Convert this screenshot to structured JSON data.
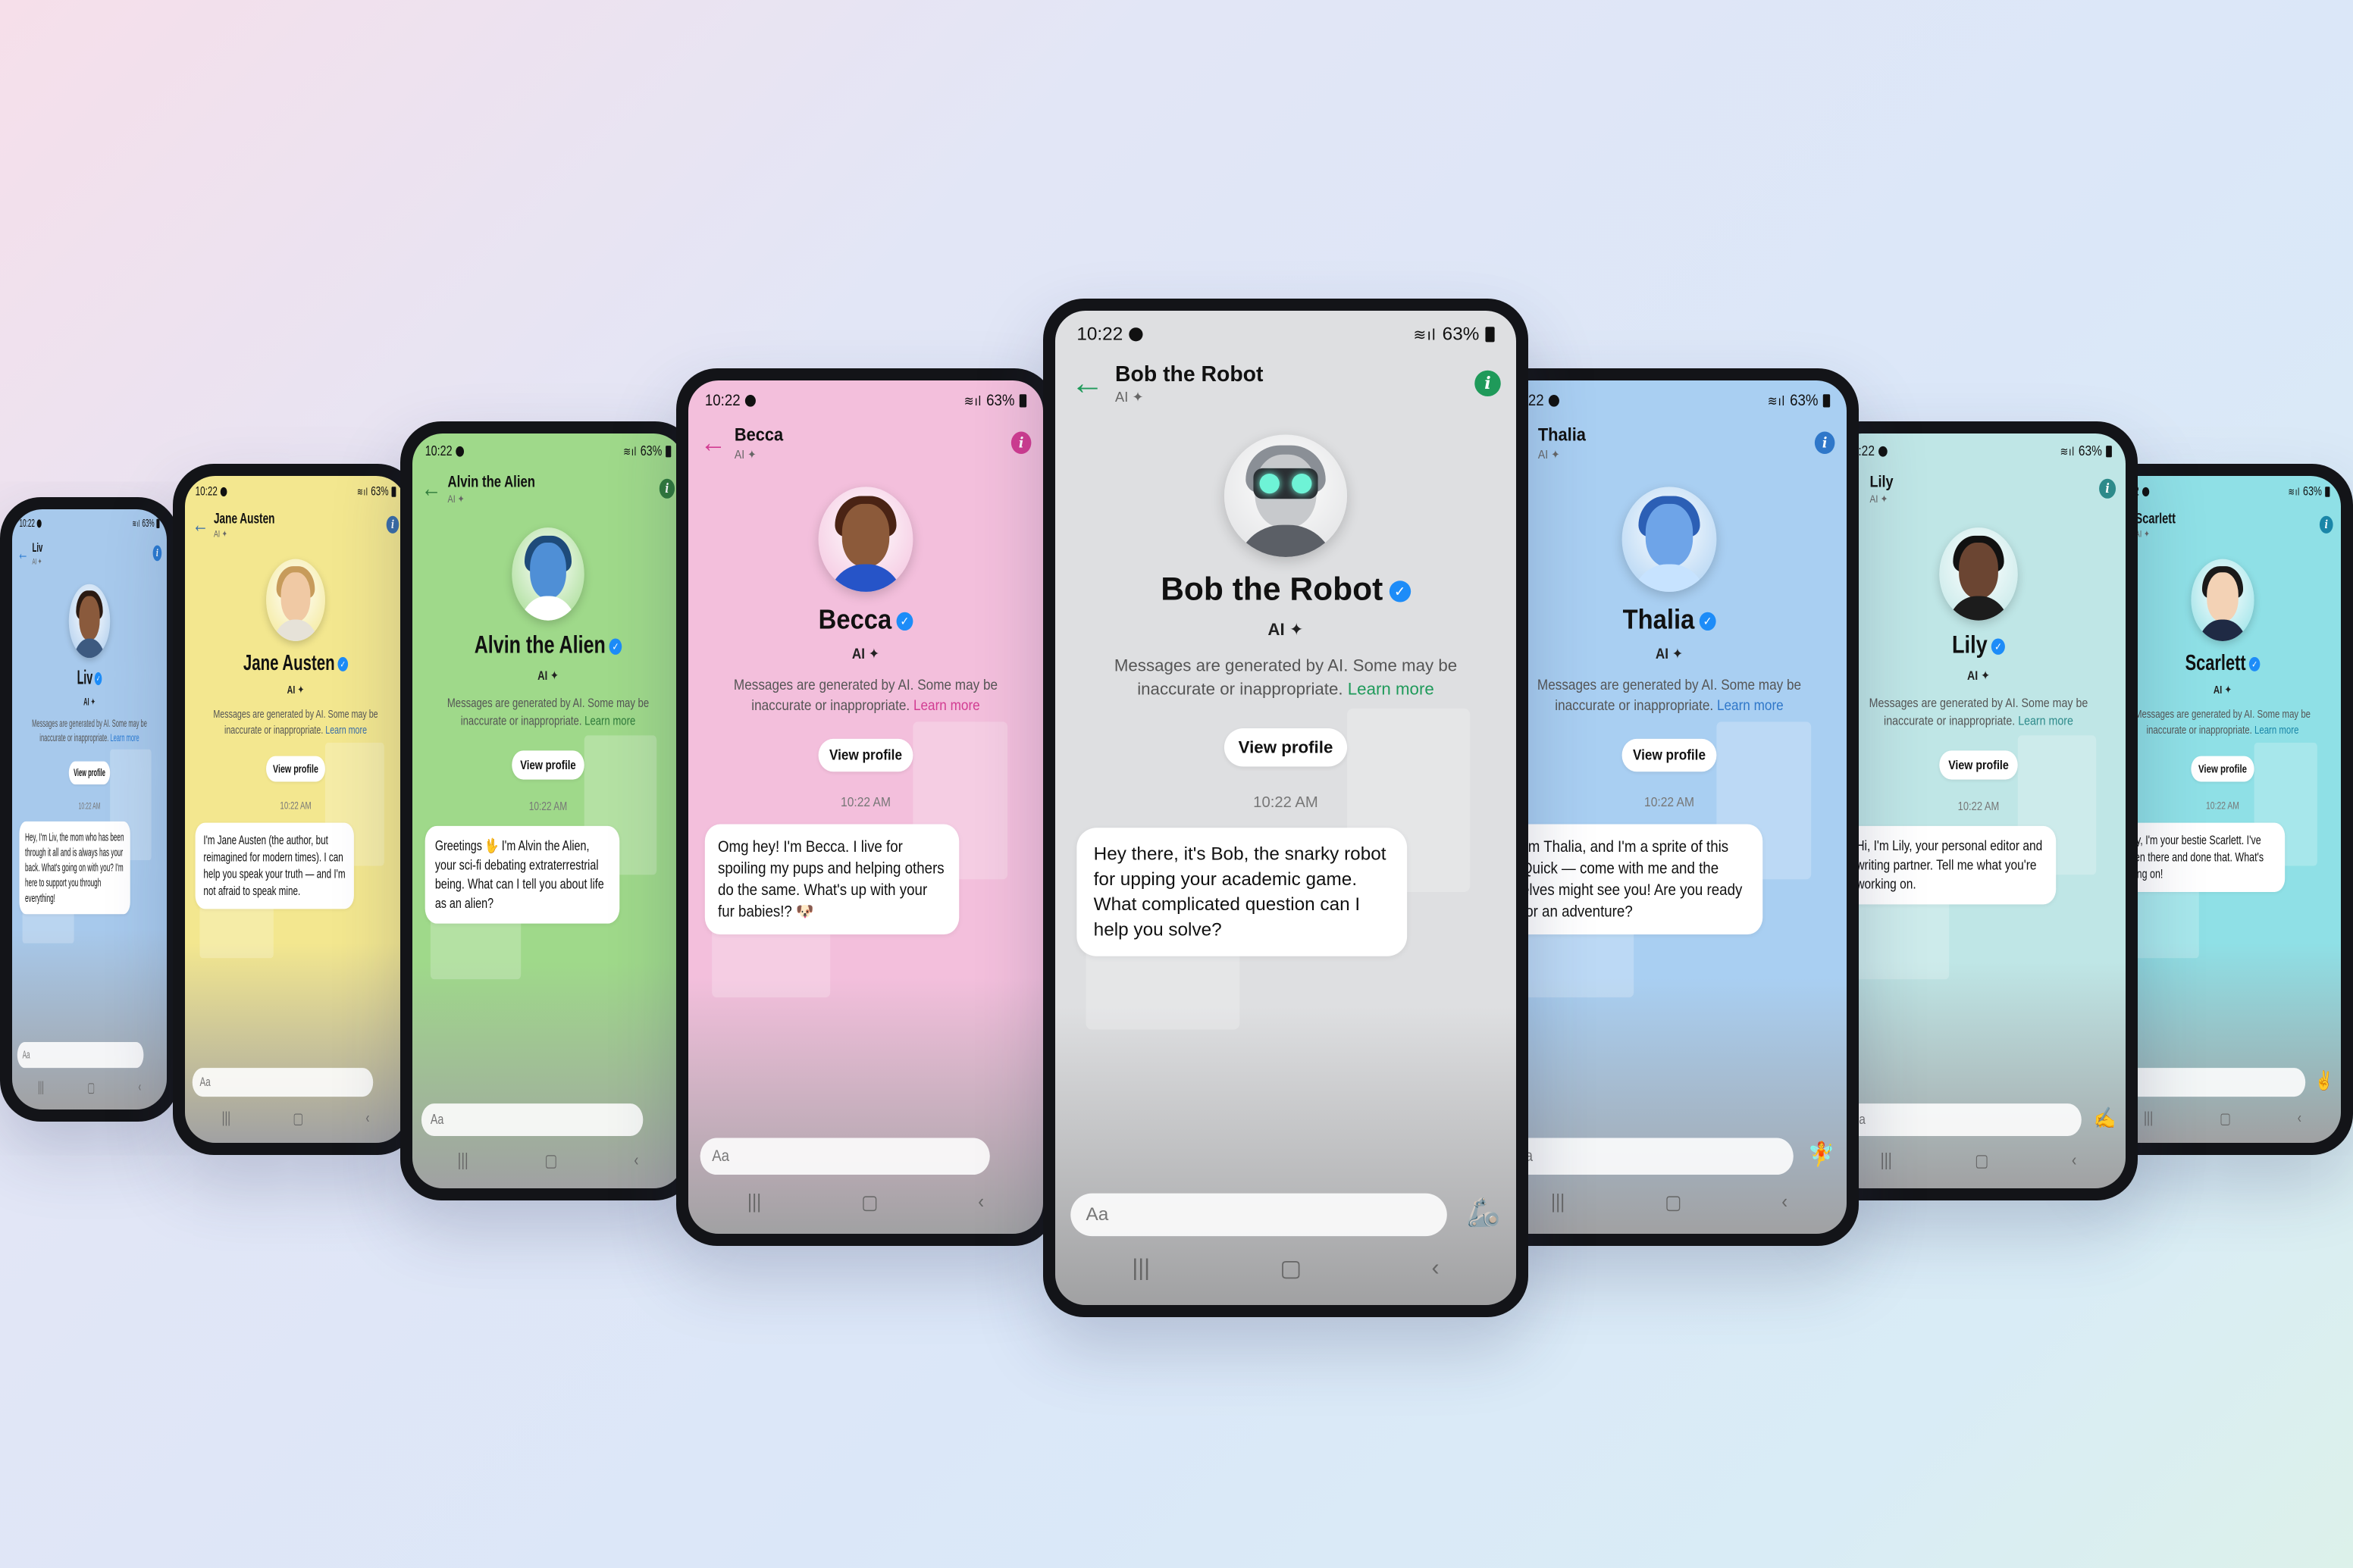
{
  "colors": {
    "verified": "#1d8cf8"
  },
  "icons": {
    "back": "arrow-left-icon",
    "info": "info-icon",
    "verified": "verified-badge-icon",
    "ai_sparkle": "sparkle-icon",
    "nav_recent": "recent-apps-icon",
    "nav_home": "home-icon",
    "nav_back": "nav-back-icon"
  },
  "common": {
    "time": "10:22",
    "battery": "63%",
    "ai_label": "AI ✦",
    "view_profile": "View profile",
    "message_time": "10:22 AM",
    "input_placeholder": "Aa",
    "nav_recent": "|||",
    "nav_home": "▢",
    "nav_back": "‹"
  },
  "phones": [
    {
      "name": "Liv",
      "theme": {
        "bg": "#a7c9ec",
        "accent": "#2b7bd2"
      },
      "disclaimer": "Messages are generated by AI. Some may be inaccurate or inappropriate.",
      "learn_more": "Learn more",
      "message": "Hey, I'm Liv, the mom who has been through it all and is always has your back. What's going on with you? I'm here to support you through everything!",
      "emoji": ""
    },
    {
      "name": "Jane Austen",
      "theme": {
        "bg": "#f3e78f",
        "accent": "#3a6ea8"
      },
      "disclaimer": "Messages are generated by AI. Some may be inaccurate or inappropriate.",
      "learn_more": "Learn more",
      "message": "I'm Jane Austen (the author, but reimagined for modern times). I can help you speak your truth — and I'm not afraid to speak mine.",
      "emoji": ""
    },
    {
      "name": "Alvin the Alien",
      "theme": {
        "bg": "#9fd98a",
        "accent": "#2f7a3b"
      },
      "disclaimer": "Messages are generated by AI. Some may be inaccurate or inappropriate.",
      "learn_more": "Learn more",
      "message": "Greetings 🖖 I'm Alvin the Alien, your sci-fi debating extraterrestrial being. What can I tell you about life as an alien?",
      "emoji": ""
    },
    {
      "name": "Becca",
      "theme": {
        "bg": "#f3bfdc",
        "accent": "#d23c92"
      },
      "disclaimer": "Messages are generated by AI. Some may be inaccurate or inappropriate.",
      "learn_more": "Learn more",
      "message": "Omg hey! I'm Becca. I live for spoiling my pups and helping others do the same. What's up with your fur babies!? 🐶",
      "emoji": ""
    },
    {
      "name": "Bob the Robot",
      "theme": {
        "bg": "#dedfe1",
        "accent": "#1f9a5a"
      },
      "disclaimer": "Messages are generated by AI. Some may be inaccurate or inappropriate.",
      "learn_more": "Learn more",
      "message": "Hey there, it's Bob, the snarky robot for upping your academic game. What complicated question can I help you solve?",
      "emoji": "🦾"
    },
    {
      "name": "Thalia",
      "theme": {
        "bg": "#a9cff2",
        "accent": "#2f77c9"
      },
      "disclaimer": "Messages are generated by AI. Some may be inaccurate or inappropriate.",
      "learn_more": "Learn more",
      "message": "I'm Thalia, and I'm a sprite of this Quick — come with me and the elves might see you! Are you ready for an adventure?",
      "emoji": "🧚"
    },
    {
      "name": "Lily",
      "theme": {
        "bg": "#bfe6e6",
        "accent": "#2d8a8a"
      },
      "disclaimer": "Messages are generated by AI. Some may be inaccurate or inappropriate.",
      "learn_more": "Learn more",
      "message": "Hi, I'm Lily, your personal editor and writing partner. Tell me what you're working on.",
      "emoji": "✍️"
    },
    {
      "name": "Scarlett",
      "theme": {
        "bg": "#8fe0e6",
        "accent": "#1a86a8"
      },
      "disclaimer": "Messages are generated by AI. Some may be inaccurate or inappropriate.",
      "learn_more": "Learn more",
      "message": "Hey, I'm your bestie Scarlett. I've been there and done that. What's going on!",
      "emoji": "✌️"
    }
  ]
}
